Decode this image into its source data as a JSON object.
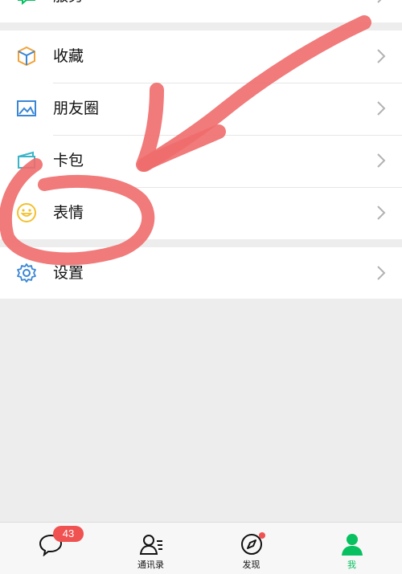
{
  "menu": {
    "top_partial": {
      "label": "服务",
      "icon": "service-icon"
    },
    "items": [
      {
        "label": "收藏",
        "icon": "favorites-cube-icon",
        "color": "#f0a33a"
      },
      {
        "label": "朋友圈",
        "icon": "moments-image-icon",
        "color": "#3a86d6"
      },
      {
        "label": "卡包",
        "icon": "card-wallet-icon",
        "color": "#3ab6c8"
      },
      {
        "label": "表情",
        "icon": "emoji-smiley-icon",
        "color": "#f2c12e"
      },
      {
        "label": "设置",
        "icon": "settings-gear-icon",
        "color": "#3a86d6"
      }
    ]
  },
  "tabbar": {
    "tabs": [
      {
        "label": "",
        "icon": "chat-bubble-icon",
        "badge": "43"
      },
      {
        "label": "通讯录",
        "icon": "contacts-icon"
      },
      {
        "label": "发现",
        "icon": "discover-compass-icon",
        "dot": true
      },
      {
        "label": "我",
        "icon": "me-person-icon",
        "active": true
      }
    ],
    "active_color": "#07c160"
  },
  "annotation": {
    "color": "#f06b6b"
  }
}
